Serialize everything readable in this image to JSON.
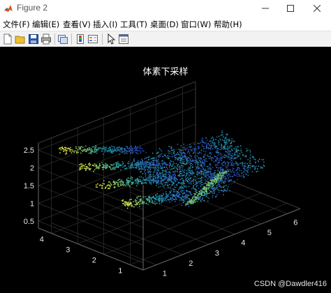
{
  "window": {
    "title": "Figure 2",
    "icon": "matlab-icon"
  },
  "menu": [
    "文件(F)",
    "编辑(E)",
    "查看(V)",
    "插入(I)",
    "工具(T)",
    "桌面(D)",
    "窗口(W)",
    "帮助(H)"
  ],
  "toolbar": [
    "new-figure-icon",
    "open-file-icon",
    "save-icon",
    "print-icon",
    "link-plot-icon",
    "insert-colorbar-icon",
    "insert-legend-icon",
    "pointer-icon",
    "property-editor-icon"
  ],
  "colors": {
    "background": "#000000",
    "point_low": "#2a2ab8",
    "point_mid": "#1fa5a8",
    "point_high": "#f5e92a"
  },
  "plot_title": "体素下采样",
  "watermark": "CSDN @Dawdler416",
  "chart_data": {
    "type": "scatter",
    "title": "体素下采样",
    "x_ticks": [
      "1",
      "2",
      "3",
      "4",
      "5",
      "6"
    ],
    "y_ticks": [
      "1",
      "2",
      "3",
      "4"
    ],
    "z_ticks": [
      "0.5",
      "1",
      "1.5",
      "2",
      "2.5"
    ],
    "xlim": [
      0.5,
      6.5
    ],
    "ylim": [
      0.5,
      4.5
    ],
    "zlim": [
      0.3,
      2.7
    ],
    "grid": true,
    "colormap": "parula"
  }
}
